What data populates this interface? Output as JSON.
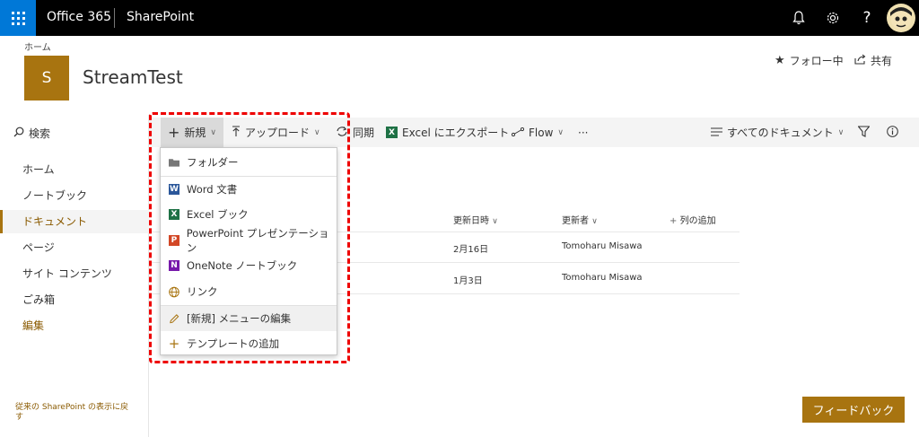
{
  "topbar": {
    "brand": "Office 365",
    "app": "SharePoint",
    "icons": [
      "bell-icon",
      "gear-icon",
      "help-icon"
    ]
  },
  "site": {
    "breadcrumb": "ホーム",
    "logo_letter": "S",
    "title": "StreamTest",
    "follow_label": "フォロー中",
    "share_label": "共有"
  },
  "leftnav": {
    "search": "検索",
    "items": [
      {
        "label": "ホーム"
      },
      {
        "label": "ノートブック"
      },
      {
        "label": "ドキュメント"
      },
      {
        "label": "ページ"
      },
      {
        "label": "サイト コンテンツ"
      },
      {
        "label": "ごみ箱"
      },
      {
        "label": "編集"
      }
    ],
    "footer": "従来の SharePoint の表示に戻す"
  },
  "commandbar": {
    "new": "新規",
    "upload": "アップロード",
    "sync": "同期",
    "export": "Excel にエクスポート",
    "flow": "Flow",
    "more": "···",
    "view": "すべてのドキュメント"
  },
  "list": {
    "columns": {
      "modified": "更新日時",
      "modified_by": "更新者",
      "add_column": "列の追加"
    },
    "rows": [
      {
        "modified": "2月16日",
        "modified_by": "Tomoharu Misawa"
      },
      {
        "modified": "1月3日",
        "modified_by": "Tomoharu Misawa"
      }
    ]
  },
  "new_menu": {
    "items": [
      {
        "label": "フォルダー",
        "icon": "folder-icon"
      },
      {
        "label": "Word 文書",
        "icon": "word-icon"
      },
      {
        "label": "Excel ブック",
        "icon": "excel-icon"
      },
      {
        "label": "PowerPoint プレゼンテーション",
        "icon": "powerpoint-icon"
      },
      {
        "label": "OneNote ノートブック",
        "icon": "onenote-icon"
      },
      {
        "label": "リンク",
        "icon": "globe-icon"
      },
      {
        "label": "[新規] メニューの編集",
        "icon": "pencil-icon"
      },
      {
        "label": "テンプレートの追加",
        "icon": "plus-icon"
      }
    ]
  },
  "feedback": "フィードバック",
  "colors": {
    "accent": "#a87410",
    "topbar": "#000000",
    "waffle": "#0078d7",
    "highlight": "#e00000"
  }
}
